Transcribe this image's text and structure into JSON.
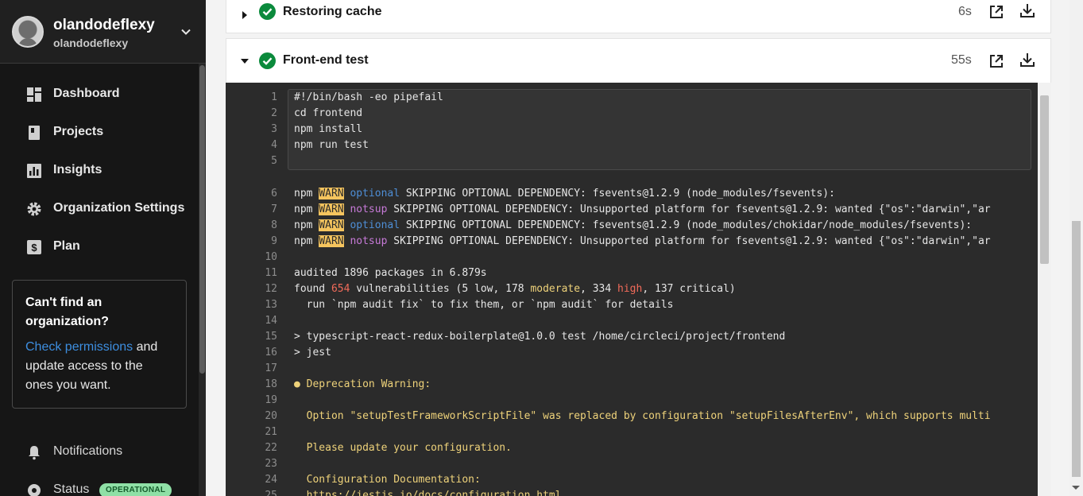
{
  "user": {
    "name": "olandodeflexy",
    "handle": "olandodeflexy"
  },
  "nav": [
    {
      "key": "dashboard",
      "label": "Dashboard",
      "icon": "dashboard-icon"
    },
    {
      "key": "projects",
      "label": "Projects",
      "icon": "projects-icon"
    },
    {
      "key": "insights",
      "label": "Insights",
      "icon": "insights-icon"
    },
    {
      "key": "organization-settings",
      "label": "Organization Settings",
      "icon": "gear-icon"
    },
    {
      "key": "plan",
      "label": "Plan",
      "icon": "dollar-icon"
    }
  ],
  "org_box": {
    "title": "Can't find an organization?",
    "link": "Check permissions",
    "text": " and update access to the ones you want."
  },
  "footer_nav": {
    "notifications": "Notifications",
    "status": "Status",
    "status_badge": "OPERATIONAL"
  },
  "steps": [
    {
      "title": "Restoring cache",
      "duration": "6s",
      "expanded": false,
      "status": "success"
    },
    {
      "title": "Front-end test",
      "duration": "55s",
      "expanded": true,
      "status": "success"
    }
  ],
  "colors": {
    "success": "#0b8a3c",
    "link": "#3d8ee0",
    "warn_bg": "#f5c45e",
    "operational_badge": "#8fe0a6"
  },
  "terminal": {
    "command_lines": [
      {
        "n": "1",
        "text": "#!/bin/bash -eo pipefail"
      },
      {
        "n": "2",
        "text": "cd frontend"
      },
      {
        "n": "3",
        "text": "npm install"
      },
      {
        "n": "4",
        "text": "npm run test"
      },
      {
        "n": "5",
        "text": ""
      }
    ],
    "output_lines": [
      {
        "n": "6",
        "parts": [
          {
            "t": "npm "
          },
          {
            "t": "WARN",
            "c": "warn"
          },
          {
            "t": " "
          },
          {
            "t": "optional",
            "c": "blue"
          },
          {
            "t": " SKIPPING OPTIONAL DEPENDENCY: fsevents@1.2.9 (node_modules/fsevents):"
          }
        ]
      },
      {
        "n": "7",
        "parts": [
          {
            "t": "npm "
          },
          {
            "t": "WARN",
            "c": "warn"
          },
          {
            "t": " "
          },
          {
            "t": "notsup",
            "c": "magenta"
          },
          {
            "t": " SKIPPING OPTIONAL DEPENDENCY: Unsupported platform for fsevents@1.2.9: wanted {\"os\":\"darwin\",\"ar"
          }
        ]
      },
      {
        "n": "8",
        "parts": [
          {
            "t": "npm "
          },
          {
            "t": "WARN",
            "c": "warn"
          },
          {
            "t": " "
          },
          {
            "t": "optional",
            "c": "blue"
          },
          {
            "t": " SKIPPING OPTIONAL DEPENDENCY: fsevents@1.2.9 (node_modules/chokidar/node_modules/fsevents):"
          }
        ]
      },
      {
        "n": "9",
        "parts": [
          {
            "t": "npm "
          },
          {
            "t": "WARN",
            "c": "warn"
          },
          {
            "t": " "
          },
          {
            "t": "notsup",
            "c": "magenta"
          },
          {
            "t": " SKIPPING OPTIONAL DEPENDENCY: Unsupported platform for fsevents@1.2.9: wanted {\"os\":\"darwin\",\"ar"
          }
        ]
      },
      {
        "n": "10",
        "parts": []
      },
      {
        "n": "11",
        "parts": [
          {
            "t": "audited 1896 packages in 6.879s"
          }
        ]
      },
      {
        "n": "12",
        "parts": [
          {
            "t": "found "
          },
          {
            "t": "654",
            "c": "red"
          },
          {
            "t": " vulnerabilities (5 low, 178 "
          },
          {
            "t": "moderate",
            "c": "yellow"
          },
          {
            "t": ", 334 "
          },
          {
            "t": "high",
            "c": "red"
          },
          {
            "t": ", 137 critical)"
          }
        ]
      },
      {
        "n": "13",
        "parts": [
          {
            "t": "  run `npm audit fix` to fix them, or `npm audit` for details"
          }
        ]
      },
      {
        "n": "14",
        "parts": []
      },
      {
        "n": "15",
        "parts": [
          {
            "t": "> typescript-react-redux-boilerplate@1.0.0 test /home/circleci/project/frontend"
          }
        ]
      },
      {
        "n": "16",
        "parts": [
          {
            "t": "> jest"
          }
        ]
      },
      {
        "n": "17",
        "parts": []
      },
      {
        "n": "18",
        "parts": [
          {
            "t": "● Deprecation Warning:",
            "c": "yellow"
          }
        ]
      },
      {
        "n": "19",
        "parts": []
      },
      {
        "n": "20",
        "parts": [
          {
            "t": "  Option \"setupTestFrameworkScriptFile\" was replaced by configuration \"setupFilesAfterEnv\", which supports multi",
            "c": "yellow"
          }
        ]
      },
      {
        "n": "21",
        "parts": []
      },
      {
        "n": "22",
        "parts": [
          {
            "t": "  Please update your configuration.",
            "c": "yellow"
          }
        ]
      },
      {
        "n": "23",
        "parts": []
      },
      {
        "n": "24",
        "parts": [
          {
            "t": "  Configuration Documentation:",
            "c": "yellow"
          }
        ]
      },
      {
        "n": "25",
        "parts": [
          {
            "t": "  https://jestjs.io/docs/configuration.html",
            "c": "yellow"
          }
        ]
      }
    ]
  }
}
